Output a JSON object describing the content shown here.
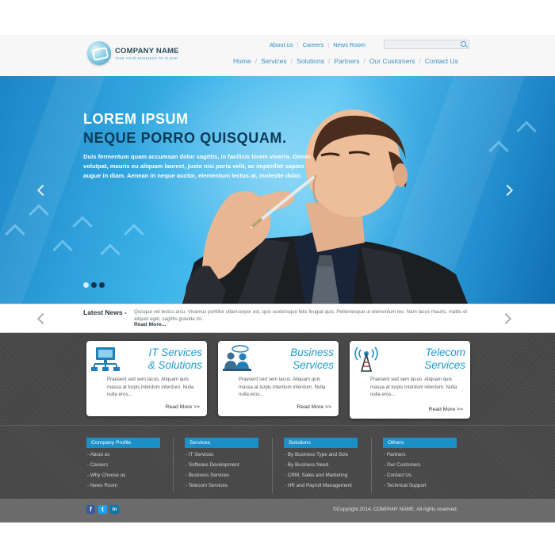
{
  "header": {
    "company_name": "COMPANY NAME",
    "tagline": "TAKE YOUR BUSINESS TO CLOUD",
    "top_links": [
      "About us",
      "Careers",
      "News Room"
    ],
    "search": {
      "placeholder": ""
    },
    "nav": [
      "Home",
      "Services",
      "Solutions",
      "Partners",
      "Our Customers",
      "Contact Us"
    ]
  },
  "hero": {
    "title_line1": "LOREM IPSUM",
    "title_line2": "NEQUE PORRO QUISQUAM.",
    "body": "Duis fermentum quam accumsan dolor sagittis, in facilisis lorem viverra. Donec volutpat, mauris eu aliquam laoreet, justo nisi porta velit, ac imperdiet sapien augue in diam. Aenean in neque auctor, elementum lectus at, molestie dolor.",
    "slides": 3,
    "active_slide": 1
  },
  "news": {
    "label": "Latest News -",
    "text": "Quisque vel lectus arcu. Vivamus porttitor ullamcorper est, quis scelerisque felis feugiat quis. Pellentesque ut elementum leo. Nam lacus mauris, mattis et aliquet eget, sagittis gravida mi.",
    "more": "Read More..."
  },
  "services": [
    {
      "title1": "IT Services",
      "title2": "& Solutions",
      "text": "Praesent sed sem lacus. Aliquam quis massa at turpis interdum interdum. Nulla nulla eros...",
      "more": "Read More >>",
      "icon": "network-icon"
    },
    {
      "title1": "Business",
      "title2": "Services",
      "text": "Praesent sed sem lacus. Aliquam quis massa at turpis interdum interdum. Nulla nulla eros...",
      "more": "Read More >>",
      "icon": "business-people-icon"
    },
    {
      "title1": "Telecom",
      "title2": "Services",
      "text": "Praesent sed sem lacus. Aliquam quis massa at turpis interdum interdum. Nulla nulla eros...",
      "more": "Read More >>",
      "icon": "antenna-icon"
    }
  ],
  "footer": {
    "columns": [
      {
        "heading": "Company Profile",
        "items": [
          "- About us",
          "- Careers",
          "- Why Choose us",
          "- News Room"
        ]
      },
      {
        "heading": "Services",
        "items": [
          "- IT Services",
          "- Software Development",
          "- Business Services",
          "- Telecom Services"
        ]
      },
      {
        "heading": "Solutions",
        "items": [
          "- By Business Type and Size",
          "- By Business Need",
          "- CRM, Sales and Marketing",
          "- HR and Payroll Management"
        ]
      },
      {
        "heading": "Others",
        "items": [
          "- Partners",
          "- Our Customers",
          "- Contact Us",
          "- Technical Support"
        ]
      }
    ],
    "social": [
      "f",
      "t",
      "in"
    ],
    "copyright": "©Copyright 2014. COMPANY NAME. All rights reserved."
  },
  "colors": {
    "accent": "#1f9bd3",
    "hero_blue": "#3db4ea",
    "footer_dark": "#4d4d4d",
    "facebook": "#3b5998",
    "twitter": "#1da1f2",
    "linkedin": "#0e76a8"
  }
}
